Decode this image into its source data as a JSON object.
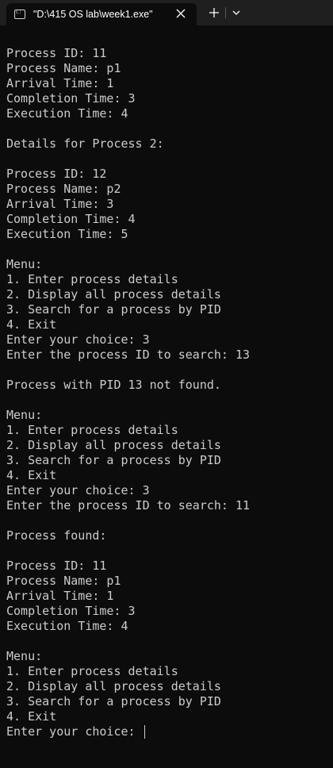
{
  "window": {
    "tab_title": "\"D:\\415 OS lab\\week1.exe\"",
    "tab_icon": "console-icon",
    "colors": {
      "titlebar_bg": "#1f1f1f",
      "terminal_bg": "#0c0c0c",
      "text": "#cccccc"
    }
  },
  "terminal": {
    "lines": [
      "Process ID: 11",
      "Process Name: p1",
      "Arrival Time: 1",
      "Completion Time: 3",
      "Execution Time: 4",
      "",
      "Details for Process 2:",
      "",
      "Process ID: 12",
      "Process Name: p2",
      "Arrival Time: 3",
      "Completion Time: 4",
      "Execution Time: 5",
      "",
      "Menu:",
      "1. Enter process details",
      "2. Display all process details",
      "3. Search for a process by PID",
      "4. Exit",
      "Enter your choice: 3",
      "Enter the process ID to search: 13",
      "",
      "Process with PID 13 not found.",
      "",
      "Menu:",
      "1. Enter process details",
      "2. Display all process details",
      "3. Search for a process by PID",
      "4. Exit",
      "Enter your choice: 3",
      "Enter the process ID to search: 11",
      "",
      "Process found:",
      "",
      "Process ID: 11",
      "Process Name: p1",
      "Arrival Time: 1",
      "Completion Time: 3",
      "Execution Time: 4",
      "",
      "Menu:",
      "1. Enter process details",
      "2. Display all process details",
      "3. Search for a process by PID",
      "4. Exit"
    ],
    "prompt": "Enter your choice: "
  }
}
